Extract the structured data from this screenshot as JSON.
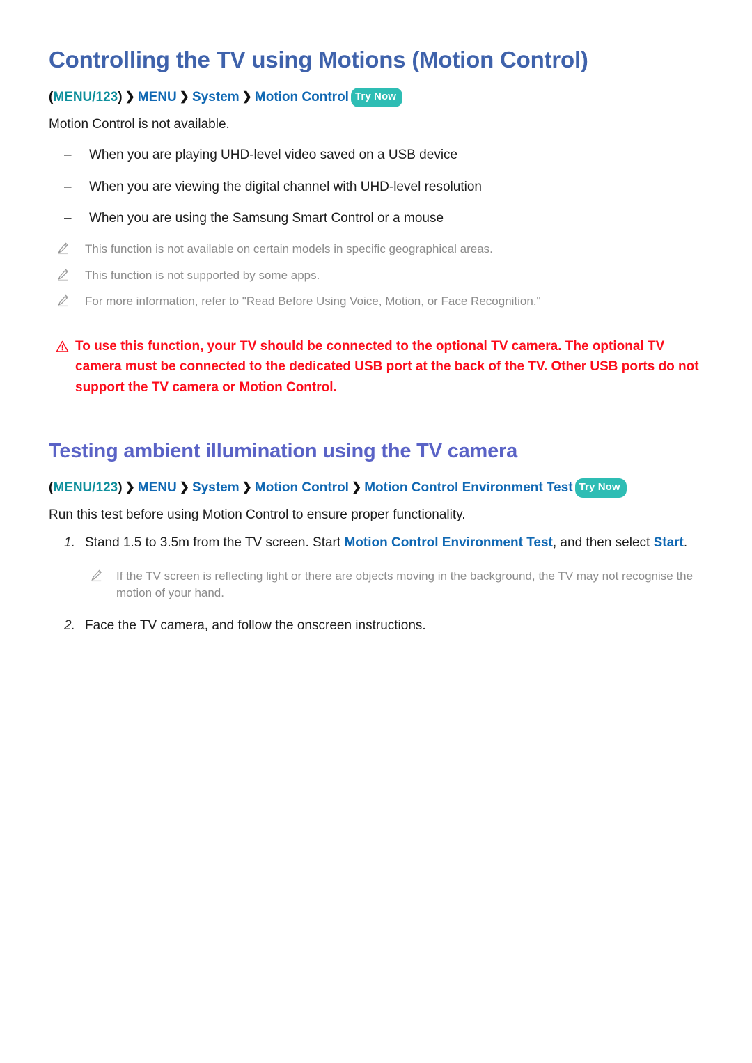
{
  "section1": {
    "title": "Controlling the TV using Motions (Motion Control)",
    "breadcrumb": {
      "open_paren": "(",
      "key": "MENU/123",
      "close_paren": ")",
      "separator": "❯",
      "items": [
        "MENU",
        "System",
        "Motion Control"
      ],
      "try_now": "Try Now"
    },
    "intro": "Motion Control is not available.",
    "dash_mark": "–",
    "conditions": [
      "When you are playing UHD-level video saved on a USB device",
      "When you are viewing the digital channel with UHD-level resolution",
      "When you are using the Samsung Smart Control or a mouse"
    ],
    "notes": [
      "This function is not available on certain models in specific geographical areas.",
      "This function is not supported by some apps.",
      "For more information, refer to \"Read Before Using Voice, Motion, or Face Recognition.\""
    ],
    "warning": "To use this function, your TV should be connected to the optional TV camera. The optional TV camera must be connected to the dedicated USB port at the back of the TV. Other USB ports do not support the TV camera or Motion Control."
  },
  "section2": {
    "title": "Testing ambient illumination using the TV camera",
    "breadcrumb": {
      "open_paren": "(",
      "key": "MENU/123",
      "close_paren": ")",
      "separator": "❯",
      "items": [
        "MENU",
        "System",
        "Motion Control",
        "Motion Control Environment Test"
      ],
      "try_now": "Try Now"
    },
    "intro": "Run this test before using Motion Control to ensure proper functionality.",
    "steps": [
      {
        "number": "1.",
        "text_before": "Stand 1.5 to 3.5m from the TV screen. Start ",
        "link1": "Motion Control Environment Test",
        "text_middle": ", and then select ",
        "link2": "Start",
        "text_after": "."
      },
      {
        "number": "2.",
        "text_before": "Face the TV camera, and follow the onscreen instructions.",
        "link1": "",
        "text_middle": "",
        "link2": "",
        "text_after": ""
      }
    ],
    "sub_note": "If the TV screen is reflecting light or there are objects moving in the background, the TV may not recognise the motion of your hand."
  },
  "icons": {
    "pencil": "pencil-icon",
    "warning": "warning-triangle-icon"
  },
  "colors": {
    "title_blue": "#3f62ab",
    "subtitle_purple": "#5a63c6",
    "breadcrumb_key_teal": "#0e8f9c",
    "breadcrumb_item_blue": "#1068b3",
    "try_now_bg": "#2ebdb4",
    "warning_red": "#fc0d1b",
    "note_grey": "#8c8c8c"
  }
}
